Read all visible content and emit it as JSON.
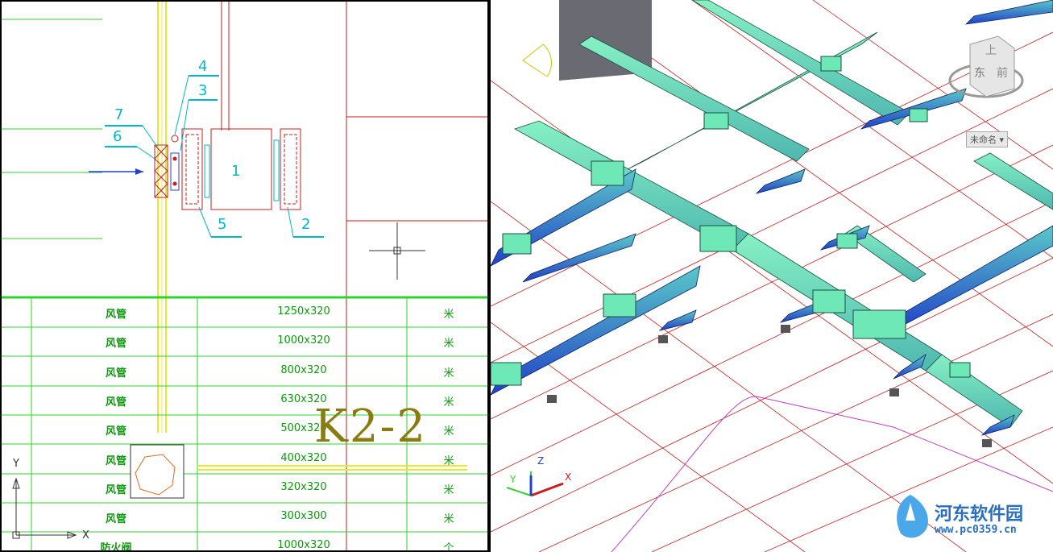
{
  "left_viewport": {
    "callouts": [
      "7",
      "6",
      "4",
      "3",
      "1",
      "5",
      "2"
    ],
    "table": {
      "rows": [
        {
          "name": "风管",
          "size": "1250x320",
          "unit": "米"
        },
        {
          "name": "风管",
          "size": "1000x320",
          "unit": "米"
        },
        {
          "name": "风管",
          "size": "800x320",
          "unit": "米"
        },
        {
          "name": "风管",
          "size": "630x320",
          "unit": "米"
        },
        {
          "name": "风管",
          "size": "500x320",
          "unit": "米"
        },
        {
          "name": "风管",
          "size": "400x320",
          "unit": "米"
        },
        {
          "name": "风管",
          "size": "320x320",
          "unit": "米"
        },
        {
          "name": "风管",
          "size": "300x300",
          "unit": "米"
        },
        {
          "name": "防火阀",
          "size": "1000x320",
          "unit": "个"
        }
      ]
    },
    "section_label": "K2-2",
    "ucs": {
      "x_label": "X",
      "y_label": "Y"
    }
  },
  "right_viewport": {
    "viewcube": {
      "top_label": "上",
      "face_label": "东",
      "front_label": "前"
    },
    "ucs_dropdown": "未命名 ▾",
    "ucs": {
      "x_label": "X",
      "y_label": "Y",
      "z_label": "Z"
    }
  },
  "watermark": {
    "name": "河东软件园",
    "url": "www.pc0359.cn"
  },
  "colors": {
    "table_lines": "#2bd52b",
    "table_text": "#0a9a0a",
    "duct_green": "#6fe8b8",
    "duct_blue": "#2f6fd8",
    "grid_red": "#c81e1e",
    "callout_cyan": "#00b8c8",
    "section_label": "#8a7a10"
  }
}
